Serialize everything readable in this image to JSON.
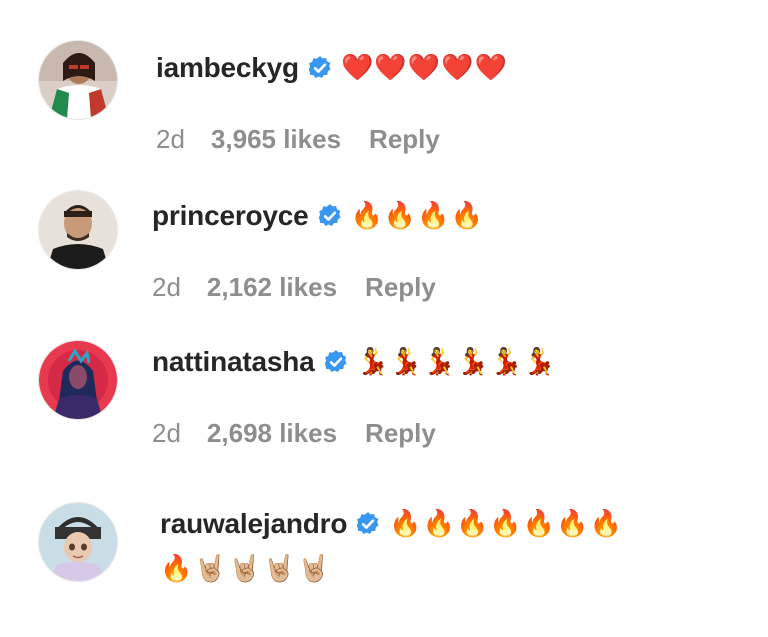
{
  "comments": [
    {
      "username": "iambeckyg",
      "text": "❤️❤️❤️❤️❤️",
      "age": "2d",
      "likes": "3,965 likes",
      "reply": "Reply"
    },
    {
      "username": "princeroyce",
      "text": "🔥🔥🔥🔥",
      "age": "2d",
      "likes": "2,162 likes",
      "reply": "Reply"
    },
    {
      "username": "nattinatasha",
      "text": "💃💃💃💃💃💃",
      "age": "2d",
      "likes": "2,698 likes",
      "reply": "Reply"
    },
    {
      "username": "rauwalejandro",
      "text": "🔥🔥🔥🔥🔥🔥🔥",
      "text_line2": "🔥🤘🏼🤘🏼🤘🏼🤘🏼"
    }
  ],
  "icons": {
    "verified": "verified-badge-icon",
    "verified_color": "#3897f0"
  }
}
